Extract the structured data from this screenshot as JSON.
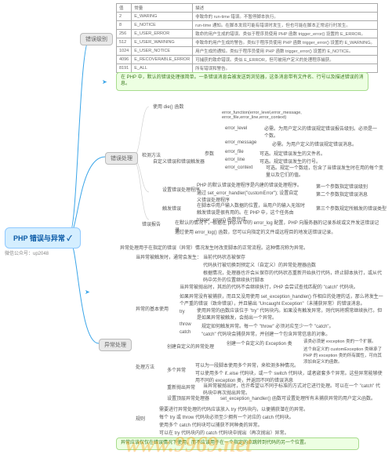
{
  "root": {
    "title": "PHP 错误与异常 ✓",
    "subtitle": "微信公众号：up2048"
  },
  "branches": {
    "level": "错误级别",
    "handle": "错误处理",
    "exception": "异常处理"
  },
  "table": {
    "header": [
      "值",
      "常量",
      "描述"
    ],
    "rows": [
      [
        "2",
        "E_WARING",
        "非致命的 run-time 错误。不暂停脚本执行。"
      ],
      [
        "8",
        "E_NOTICE",
        "run-time 通知。在脚本发现可能有错误时发生，但也可能在脚本正常运行时发生。"
      ],
      [
        "256",
        "E_USER_ERROR",
        "致命的用户生成的错误。类似于程序员使用 PHP 函数 trigger_error() 设置的 E_ERROR。"
      ],
      [
        "512",
        "E_USER_WARNING",
        "非致命的用户生成的警告。类似于程序员使用 PHP 函数 trigger_error() 设置的 E_WARNING。"
      ],
      [
        "1024",
        "E_USER_NOTICE",
        "用户生成的通知。类似于程序员使用 PHP 函数 trigger_error() 设置的 E_NOTICE。"
      ],
      [
        "4096",
        "E_RECOVERABLE_ERROR",
        "可捕获的致命错误。类似 E_ERROR，但可被用户定义的处理程序捕获。"
      ],
      [
        "8191",
        "E_ALL",
        "所有错误和警告。"
      ]
    ]
  },
  "note1": "在 PHP 中，默认的错误处理很简单。一条错误消息会被发送到浏览器，这条消息带有文件名、行号以及描述错误的消息。",
  "handle_tree": {
    "detect": "检测方法",
    "die": "使用 die() 函数",
    "custom": "自定义错误和错误触发器",
    "customfn": {
      "sig": "error_function(error_level,error_message, error_file,error_line,error_context)",
      "params": "参数",
      "p": {
        "level": [
          "error_level",
          "必需。为用户定义的错误规定错误报告级别。必须是一个数。"
        ],
        "msg": [
          "error_message",
          "必需。为用户定义的错误规定错误消息。"
        ],
        "file": [
          "error_file",
          "可选。规定错误发生的文件名。"
        ],
        "line": [
          "error_line",
          "可选。规定错误发生的行号。"
        ],
        "ctx": [
          "error_context",
          "可选。规定一个数组，包含了当错误发生时在用的每个变量以及它们的值。"
        ]
      }
    },
    "seth": {
      "title": "设置错误处理程序",
      "d1": "PHP 的默认错误处理程序是内建的错误处理程序。",
      "d2": "通过 set_error_handler(\"customError\"); 设置自定义错误处理程序",
      "p1": "第一个参数指定错误级别",
      "p2": "第二个参数指定错误消息"
    },
    "trig": {
      "title": "触发错误",
      "d": "在脚本中用户输入数据的位置，当用户的输入无效时触发错误是很有用的。在 PHP 中，这个任务由 trigger_error() 函数完成。",
      "p3": "第三个参数规定所触发的错误类型"
    },
    "log": {
      "title": "错误报告",
      "d1": "在默认的情况下，根据在 php.ini 中的 error_log 配置，PHP 向服务器的记录系统或文件发送错误记录。",
      "d2": "通过使用 error_log() 函数，您可以向指定的文件或远程目的地发送错误记录。"
    }
  },
  "ex": {
    "intro": {
      "l1": "异常处理用于在指定的错误（异常）情况发生时改变脚本的正常流程。这种情况称为异常。",
      "l2": "当异常被触发时，通常会发生：",
      "l3": "当前代码状态被保存",
      "l4": "代码执行被切换到预定义（自定义）的异常处理器函数",
      "l5": "根据情况，处理器也许会从保存的代码状态重新开始执行代码，终止脚本执行，或从代码中另外的位置继续执行脚本"
    },
    "basic": {
      "title": "异常的基本使用",
      "l1": "当异常被抛出时，其后的代码不会继续执行，PHP 会尝试查找匹配的 \"catch\" 代码块。",
      "l2": "如果异常没有被捕获，而且又没用使用 set_exception_handler() 作相应的处理的话，那么将发生一个严重的错误（致命错误），并且输出 \"Uncaught Exception\"（未捕获异常）的错误消息。",
      "try": [
        "try",
        "使用异常的函数应该位于 \"try\" 代码块内。如果没有触发异常，则代码将照常继续执行。但是如果异常被触发，会抛出一个异常。"
      ],
      "throw": [
        "throw",
        "规定如何触发异常。每一个 \"throw\" 必须对应至少一个 \"catch\"。"
      ],
      "catch": [
        "catch",
        "\"catch\" 代码块会捕获异常，并创建一个包含异常信息的对象。"
      ]
    },
    "method": {
      "title": "处理方法",
      "custom": [
        "创建自定义的异常处理",
        "创建一个自定义的 Exception 类",
        "该类必须是 exception 类的一个扩展。",
        "这个自定义的 customException 类继承了 PHP 的 exception 类的所有属性，可向其添加自定义的函数。"
      ],
      "multi": [
        "多个异常",
        "可以为一段脚本使用多个异常，来检测多种情况。",
        "可以使用多个 if..else 代码块，或一个 switch 代码块，或者嵌套多个异常。这些异常能够使用不同的 exception 类，并返回不同的错误消息"
      ],
      "rethrow": [
        "重新抛出异常",
        "当异常被抛出时，也许希望以不同于标准的方式对它进行处理。可以在一个 \"catch\" 代码块中再次抛出异常。"
      ],
      "top": [
        "设置顶层异常处理器",
        "set_exception_handler() 函数可设置处理所有未捕获异常的用户定义函数。"
      ]
    },
    "rule": {
      "title": "规则",
      "r1": "需要进行异常处理的代码应该放入 try 代码块内，以便捕获潜在的异常。",
      "r2": "每个 try 或 throw 代码块必须至少拥有一个对应的 catch 代码块。",
      "r3": "使用多个 catch 代码块可以捕获不同种类的异常。",
      "r4": "可以在 try 代码块内的 catch 代码块中抛出（再次抛出）异常。"
    },
    "note2": "异常应该仅仅在错误情况下使用，而不应该用于在一个指定的点跳转到代码的另一个位置。"
  },
  "watermark": "www.9969.net"
}
